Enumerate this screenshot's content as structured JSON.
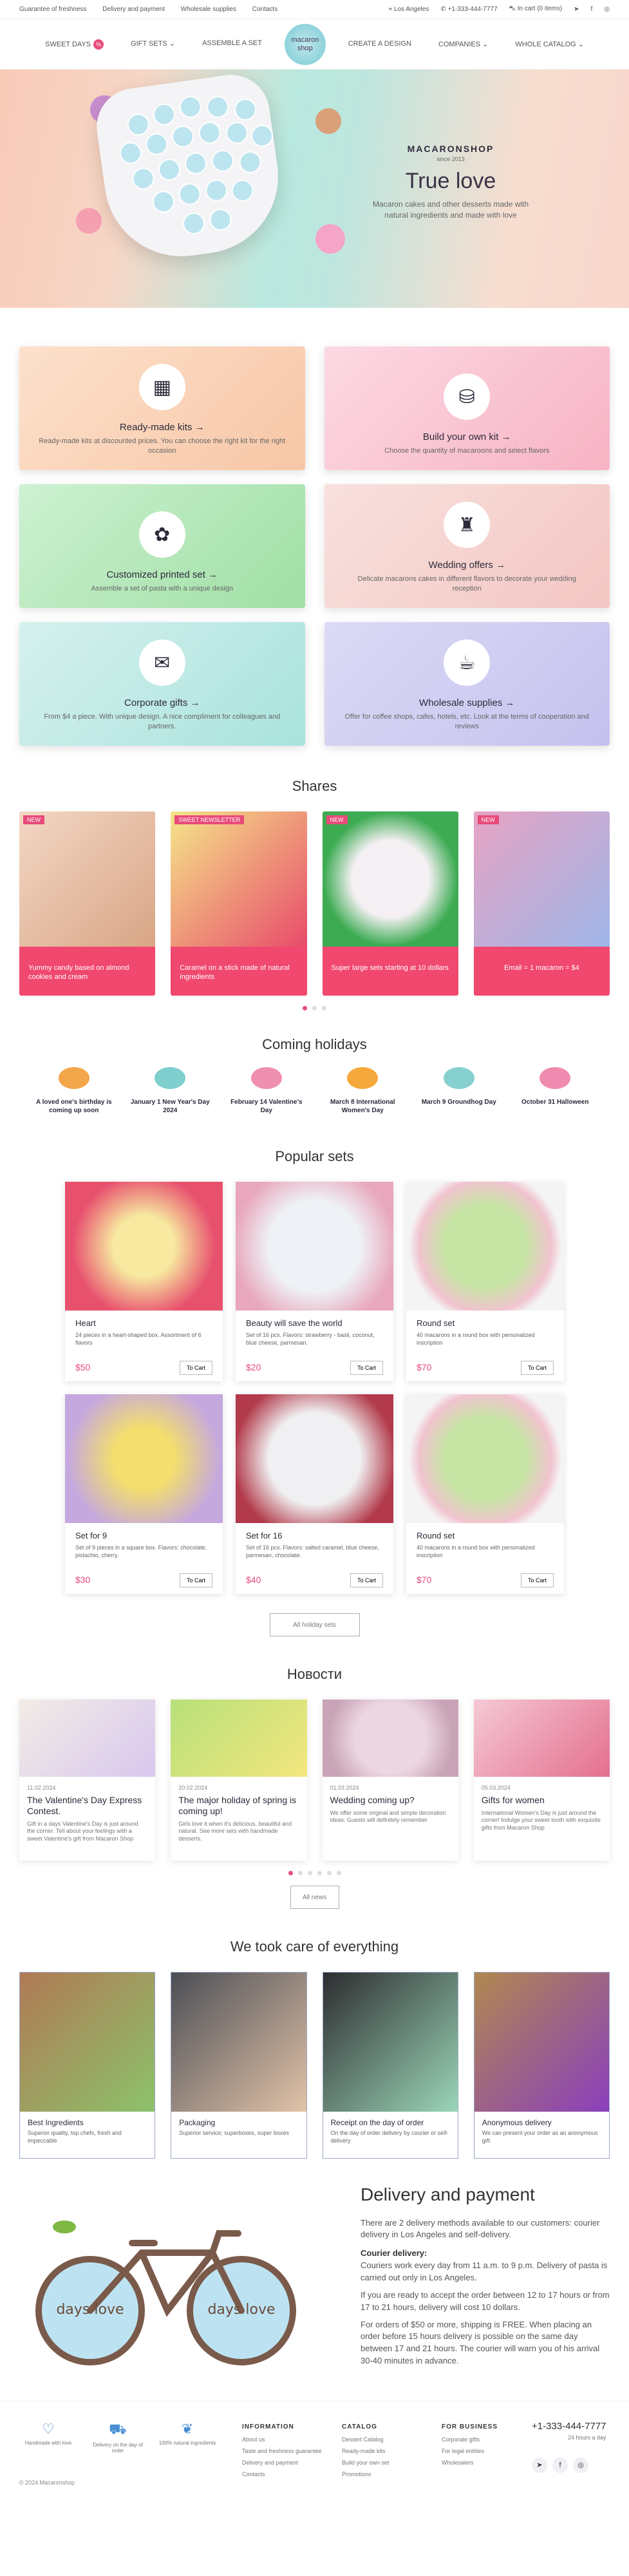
{
  "topbar": {
    "links": [
      "Guarantee of freshness",
      "Delivery and payment",
      "Wholesale supplies",
      "Contacts"
    ],
    "city": "Los Angeles",
    "phone": "+1-333-444-7777",
    "cart": "In cart (0 items)"
  },
  "nav": {
    "left": [
      "SWEET DAYS",
      "GIFT SETS",
      "ASSEMBLE A SET"
    ],
    "badge": "%",
    "right": [
      "CREATE A DESIGN",
      "COMPANIES",
      "WHOLE CATALOG"
    ],
    "logo_line1": "macaron",
    "logo_line2": "shop"
  },
  "hero": {
    "brand": "MACARONSHOP",
    "since": "since 2013",
    "title": "True love",
    "subtitle": "Macaron cakes and other desserts made with natural ingredients and made with love"
  },
  "cards": [
    {
      "title": "Ready-made kits →",
      "text": "Ready-made kits at discounted prices. You can choose the right kit for the right occasion",
      "icon": "▦"
    },
    {
      "title": "Build your own kit →",
      "text": "Choose the quantity of macaroons and select flavors",
      "icon": "⛁"
    },
    {
      "title": "Customized printed set →",
      "text": "Assemble a set of pasta with a unique design",
      "icon": "✿"
    },
    {
      "title": "Wedding offers →",
      "text": "Delicate macarons cakes in different flavors to decorate your wedding reception",
      "icon": "♜"
    },
    {
      "title": "Corporate gifts →",
      "text": "From $4 a piece. With unique design. A nice compliment for colleagues and partners.",
      "icon": "✉"
    },
    {
      "title": "Wholesale supplies →",
      "text": "Offer for coffee shops, cafes, hotels, etc. Look at the terms of cooperation and reviews",
      "icon": "☕"
    }
  ],
  "shares": {
    "title": "Shares",
    "items": [
      {
        "tag": "NEW",
        "caption": "Yummy candy based on almond cookies and cream"
      },
      {
        "tag": "SWEET NEWSLETTER",
        "caption": "Caramel on a stick made of natural ingredients"
      },
      {
        "tag": "NEW",
        "caption": "Super large sets starting at 10 dollars"
      },
      {
        "tag": "NEW",
        "caption": "Email = 1 macaron = $4"
      }
    ]
  },
  "holidays": {
    "title": "Coming holidays",
    "items": [
      "A loved one's birthday is coming up soon",
      "January 1 New Year's Day 2024",
      "February 14 Valentine's Day",
      "March 8 International Women's Day",
      "March 9 Groundhog Day",
      "October 31 Halloween"
    ]
  },
  "sets": {
    "title": "Popular sets",
    "more": "All holiday sets",
    "cart": "To Cart",
    "items": [
      {
        "name": "Heart",
        "desc": "24 pieces in a heart-shaped box. Assortment of 6 flavors",
        "price": "$50"
      },
      {
        "name": "Beauty will save the world",
        "desc": "Set of 16 pcs. Flavors: strawberry - basil, coconut, blue cheese, parmesan.",
        "price": "$20"
      },
      {
        "name": "Round set",
        "desc": "40 macarons in a round box with personalized inscription",
        "price": "$70"
      },
      {
        "name": "Set for 9",
        "desc": "Set of 9 pieces in a square box. Flavors: chocolate, pistachio, cherry.",
        "price": "$30"
      },
      {
        "name": "Set for 16",
        "desc": "Set of 16 pcs. Flavors: salted caramel, blue cheese, parmesan, chocolate.",
        "price": "$40"
      },
      {
        "name": "Round set",
        "desc": "40 macarons in a round box with personalized inscription",
        "price": "$70"
      }
    ]
  },
  "news": {
    "title": "Новости",
    "more": "All news",
    "items": [
      {
        "date": "11.02.2024",
        "title": "The Valentine's Day Express Contest.",
        "text": "Gift in a days Valentine's Day is just around the corner. Tell about your feelings with a sweet Valentine's gift from Macaron Shop"
      },
      {
        "date": "20.02.2024",
        "title": "The major holiday of spring is coming up!",
        "text": "Girls love it when it's delicious, beautiful and natural. See more sets with handmade desserts."
      },
      {
        "date": "01.03.2024",
        "title": "Wedding coming up?",
        "text": "We offer some original and simple decoration ideas. Guests will definitely remember"
      },
      {
        "date": "05.03.2024",
        "title": "Gifts for women",
        "text": "International Women's Day is just around the corner! Indulge your sweet tooth with exquisite gifts from Macaron Shop"
      }
    ]
  },
  "care": {
    "title": "We took care of everything",
    "items": [
      {
        "title": "Best Ingredients",
        "text": "Superior quality, top chefs, fresh and impeccable"
      },
      {
        "title": "Packaging",
        "text": "Superior service; superboxes, super boxes"
      },
      {
        "title": "Receipt on the day of order",
        "text": "On the day of order delivery by courier or self-delivery"
      },
      {
        "title": "Anonymous delivery",
        "text": "We can present your order as an anonymous gift."
      }
    ]
  },
  "delivery": {
    "title": "Delivery and payment",
    "intro": "There are 2 delivery methods available to our customers: courier delivery in Los Angeles and self-delivery.",
    "courier_label": "Courier delivery:",
    "p1": "Couriers work every day from 11 a.m. to 9 p.m. Delivery of pasta is carried out only in Los Angeles.",
    "p2": "If you are ready to accept the order between 12 to 17 hours or from 17 to 21 hours, delivery will cost 10 dollars.",
    "p3": "For orders of $50 or more, shipping is FREE. When placing an order before 15 hours delivery is possible on the same day between 17 and 21 hours. The courier will warn you of his arrival 30-40 minutes in advance.",
    "bike_text": "days love"
  },
  "footer": {
    "features": [
      "Handmade with love",
      "Delivery on the day of order",
      "100% natural ingredients"
    ],
    "info_title": "INFORMATION",
    "info": [
      "About us",
      "Taste and freshness guarantee",
      "Delivery and payment",
      "Contacts"
    ],
    "catalog_title": "CATALOG",
    "catalog": [
      "Dessert Catalog",
      "Ready-made kits",
      "Build your own set",
      "Promotions"
    ],
    "business_title": "FOR BUSINESS",
    "business": [
      "Corporate gifts",
      "For legal entities",
      "Wholesalers"
    ],
    "phone": "+1-333-444-7777",
    "hours": "24 hours a day",
    "copyright": "© 2024 Macaronshop"
  },
  "colors": {
    "accent": "#e84b7a",
    "share_caption": "#f0486f"
  }
}
